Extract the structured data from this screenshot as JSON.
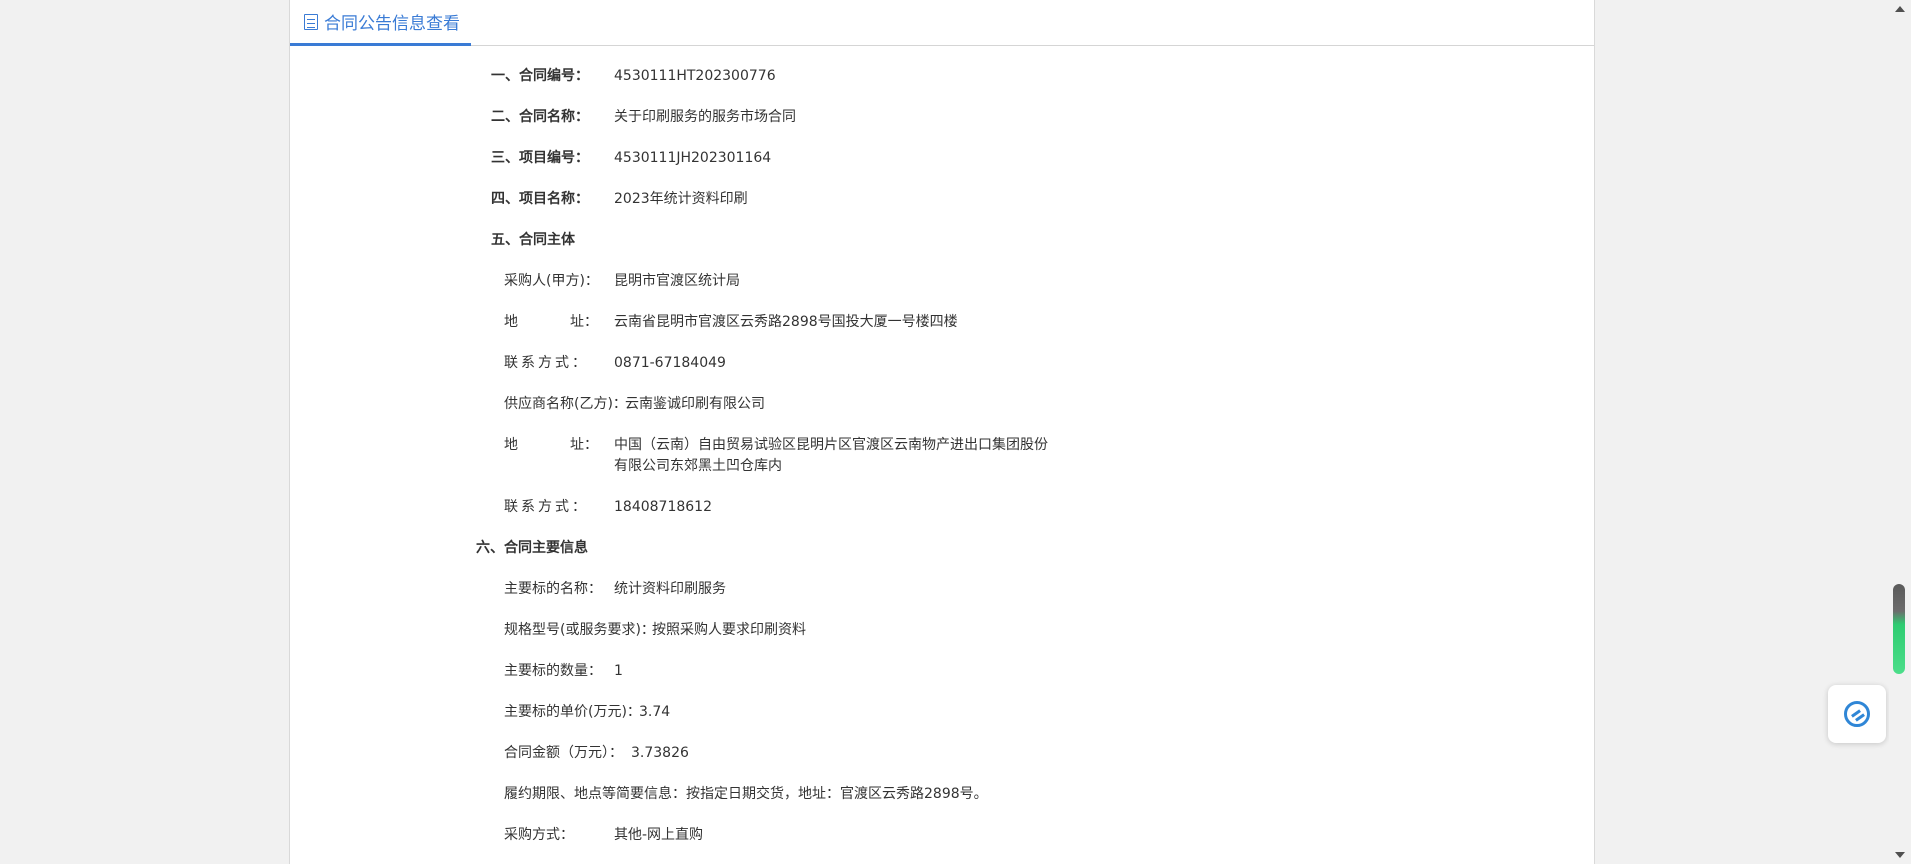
{
  "tab": {
    "label": "合同公告信息查看",
    "icon": "document-list-icon"
  },
  "sections": {
    "s1": {
      "label": "一、合同编号：",
      "value": "4530111HT202300776"
    },
    "s2": {
      "label": "二、合同名称：",
      "value": "关于印刷服务的服务市场合同"
    },
    "s3": {
      "label": "三、项目编号：",
      "value": "4530111JH202301164"
    },
    "s4": {
      "label": "四、项目名称：",
      "value": "2023年统计资料印刷"
    },
    "s5": {
      "label": "五、合同主体"
    },
    "s6": {
      "label": "六、合同主要信息"
    }
  },
  "party_a": {
    "name_label": "采购人(甲方)：",
    "name_value": "昆明市官渡区统计局",
    "addr_label_left": "地",
    "addr_label_right": "址：",
    "addr_value": "云南省昆明市官渡区云秀路2898号国投大厦一号楼四楼",
    "contact_label": "联系方式：",
    "contact_value": "0871-67184049"
  },
  "party_b": {
    "name_label": "供应商名称(乙方)：",
    "name_value": "云南鉴诚印刷有限公司",
    "addr_label_left": "地",
    "addr_label_right": "址：",
    "addr_value_line1": "中国（云南）自由贸易试验区昆明片区官渡区云南物产进出口集团股份",
    "addr_value_line2": "有限公司东郊黑土凹仓库内",
    "contact_label": "联系方式：",
    "contact_value": "18408718612"
  },
  "main_info": {
    "subject_label": "主要标的名称：",
    "subject_value": "统计资料印刷服务",
    "spec_label": "规格型号(或服务要求)：",
    "spec_value": "按照采购人要求印刷资料",
    "qty_label": "主要标的数量：",
    "qty_value": "1",
    "price_label": "主要标的单价(万元)：",
    "price_value": "3.74",
    "amount_label": "合同金额（万元）：",
    "amount_value": "3.73826",
    "terms_label": "履约期限、地点等简要信息：",
    "terms_value": "按指定日期交货，地址：官渡区云秀路2898号。",
    "method_label": "采购方式：",
    "method_value": "其他-网上直购"
  },
  "float_button": {
    "icon": "customer-service-icon"
  },
  "colors": {
    "accent": "#3a7bd5",
    "scroll_green": "#2ecc71"
  }
}
